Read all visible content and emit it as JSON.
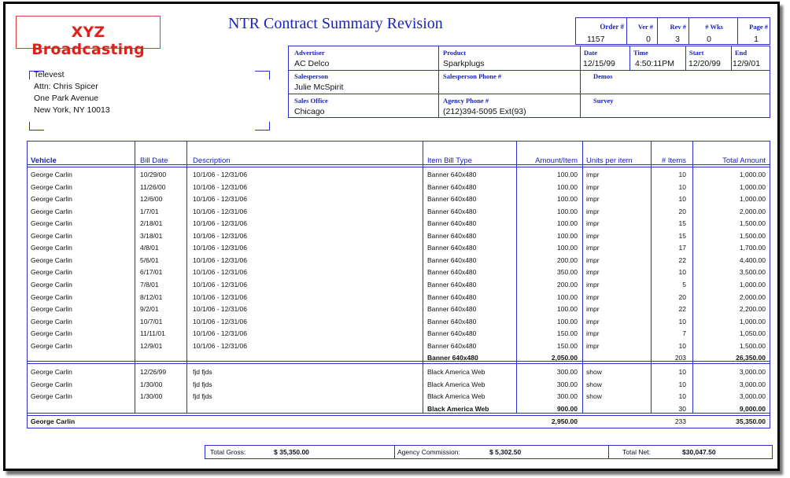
{
  "app": {
    "logo": "XYZ Broadcasting",
    "title": "NTR Contract Summary Revision"
  },
  "order_info": {
    "headers": [
      "Order #",
      "Ver #",
      "Rev #",
      "# Wks",
      "Page #"
    ],
    "values": [
      "1157",
      "0",
      "3",
      "0",
      "1"
    ]
  },
  "contract": {
    "advertiser_label": "Advertiser",
    "advertiser": "AC Delco",
    "product_label": "Product",
    "product": "Sparkplugs",
    "date_label": "Date",
    "date": "12/15/99",
    "time_label": "Time",
    "time": "4:50:11PM",
    "start_label": "Start",
    "start": "12/20/99",
    "end_label": "End",
    "end": "12/9/01",
    "salesperson_label": "Salesperson",
    "salesperson": "Julie McSpirit",
    "salesperson_phone_label": "Salesperson Phone #",
    "salesperson_phone": "",
    "demos_label": "Demos",
    "demos": "",
    "sales_office_label": "Sales Office",
    "sales_office": "Chicago",
    "agency_phone_label": "Agency Phone #",
    "agency_phone": "(212)394-5095 Ext(93)",
    "survey_label": "Survey",
    "survey": ""
  },
  "address": [
    "Televest",
    "Attn: Chris Spicer",
    "One Park Avenue",
    "New York, NY  10013"
  ],
  "table": {
    "columns": [
      "Vehicle",
      "Bill Date",
      "Description",
      "Item Bill Type",
      "Amount/Item",
      "Units per item",
      "# Items",
      "Total Amount"
    ],
    "group1": [
      [
        "George Carlin",
        "10/29/00",
        "10/1/06 - 12/31/06",
        "Banner 640x480",
        "100.00",
        "impr",
        "10",
        "1,000.00"
      ],
      [
        "George Carlin",
        "11/26/00",
        "10/1/06 - 12/31/06",
        "Banner 640x480",
        "100.00",
        "impr",
        "10",
        "1,000.00"
      ],
      [
        "George Carlin",
        "12/6/00",
        "10/1/06 - 12/31/06",
        "Banner 640x480",
        "100.00",
        "impr",
        "10",
        "1,000.00"
      ],
      [
        "George Carlin",
        "1/7/01",
        "10/1/06 - 12/31/06",
        "Banner 640x480",
        "100.00",
        "impr",
        "20",
        "2,000.00"
      ],
      [
        "George Carlin",
        "2/18/01",
        "10/1/06 - 12/31/06",
        "Banner 640x480",
        "100.00",
        "impr",
        "15",
        "1,500.00"
      ],
      [
        "George Carlin",
        "3/18/01",
        "10/1/06 - 12/31/06",
        "Banner 640x480",
        "100.00",
        "impr",
        "15",
        "1,500.00"
      ],
      [
        "George Carlin",
        "4/8/01",
        "10/1/06 - 12/31/06",
        "Banner 640x480",
        "100.00",
        "impr",
        "17",
        "1,700.00"
      ],
      [
        "George Carlin",
        "5/6/01",
        "10/1/06 - 12/31/06",
        "Banner 640x480",
        "200.00",
        "impr",
        "22",
        "4,400.00"
      ],
      [
        "George Carlin",
        "6/17/01",
        "10/1/06 - 12/31/06",
        "Banner 640x480",
        "350.00",
        "impr",
        "10",
        "3,500.00"
      ],
      [
        "George Carlin",
        "7/8/01",
        "10/1/06 - 12/31/06",
        "Banner 640x480",
        "200.00",
        "impr",
        "5",
        "1,000.00"
      ],
      [
        "George Carlin",
        "8/12/01",
        "10/1/06 - 12/31/06",
        "Banner 640x480",
        "100.00",
        "impr",
        "20",
        "2,000.00"
      ],
      [
        "George Carlin",
        "9/2/01",
        "10/1/06 - 12/31/06",
        "Banner 640x480",
        "100.00",
        "impr",
        "22",
        "2,200.00"
      ],
      [
        "George Carlin",
        "10/7/01",
        "10/1/06 - 12/31/06",
        "Banner 640x480",
        "100.00",
        "impr",
        "10",
        "1,000.00"
      ],
      [
        "George Carlin",
        "11/11/01",
        "10/1/06 - 12/31/06",
        "Banner 640x480",
        "150.00",
        "impr",
        "7",
        "1,050.00"
      ],
      [
        "George Carlin",
        "12/9/01",
        "10/1/06 - 12/31/06",
        "Banner 640x480",
        "150.00",
        "impr",
        "10",
        "1,500.00"
      ]
    ],
    "subtotal1": {
      "type": "Banner 640x480",
      "amount": "2,050.00",
      "items": "203",
      "total": "26,350.00"
    },
    "group2": [
      [
        "George Carlin",
        "12/26/99",
        "fjd fjds",
        "Black America Web",
        "300.00",
        "show",
        "10",
        "3,000.00"
      ],
      [
        "George Carlin",
        "1/30/00",
        "fjd fjds",
        "Black America Web",
        "300.00",
        "show",
        "10",
        "3,000.00"
      ],
      [
        "George Carlin",
        "1/30/00",
        "fjd fjds",
        "Black America Web",
        "300.00",
        "show",
        "10",
        "3,000.00"
      ]
    ],
    "subtotal2": {
      "type": "Black America Web",
      "amount": "900.00",
      "items": "30",
      "total": "9,000.00"
    },
    "grand": {
      "vehicle": "George Carlin",
      "amount": "2,950.00",
      "items": "233",
      "total": "35,350.00"
    }
  },
  "totals": {
    "gross_label": "Total Gross:",
    "gross": "$ 35,350.00",
    "commission_label": "Agency Commission:",
    "commission": "$ 5,302.50",
    "net_label": "Total Net:",
    "net": "$30,047.50"
  }
}
